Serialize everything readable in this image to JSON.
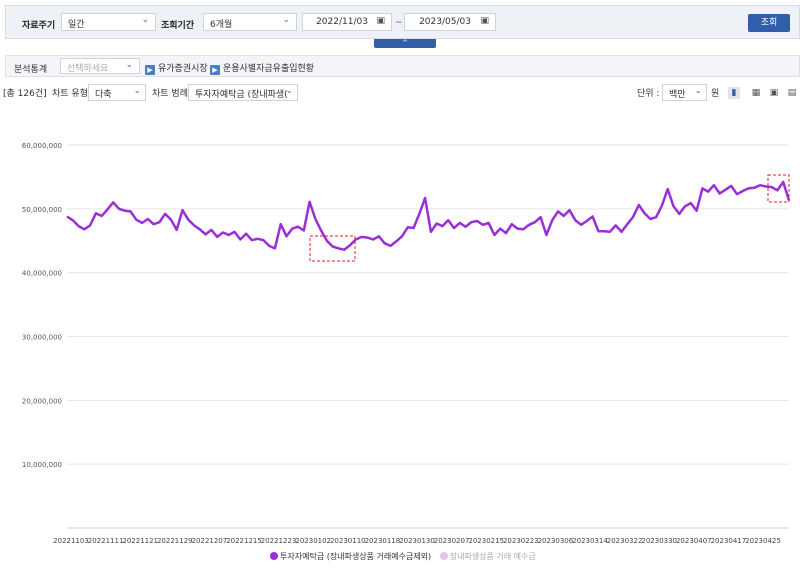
{
  "filter": {
    "period_label": "자료주기",
    "period_value": "일간",
    "range_label": "조회기간",
    "range_value": "6개월",
    "date_from": "2022/11/03",
    "date_to": "2023/05/03",
    "tilde": "~",
    "query_button": "조회",
    "collapse": "^"
  },
  "analysis": {
    "label": "분석통계",
    "placeholder": "선택하세요",
    "link1": "유가증권시장",
    "link2": "운용사별자금유출입현황"
  },
  "toolbar": {
    "count": "[총 126건]",
    "chart_type_label": "차트 유형",
    "chart_type_value": "다축",
    "legend_label": "차트 범례",
    "legend_value": "투자자예탁금 (장내파생(",
    "unit_label": "단위 :",
    "unit_value": "백만",
    "unit_suffix": "원"
  },
  "colors": {
    "series1": "#9b2fd6",
    "series2": "#e0c4f0",
    "accent": "#2f5fa8"
  },
  "chart_data": {
    "type": "line",
    "ylim": [
      0,
      60000000
    ],
    "y_ticks": [
      "10,000,000",
      "20,000,000",
      "30,000,000",
      "40,000,000",
      "50,000,000",
      "60,000,000"
    ],
    "x_tick_labels": [
      "20221103",
      "20221111",
      "20221121",
      "20221129",
      "20221207",
      "20221215",
      "20221223",
      "20230102",
      "20230110",
      "20230118",
      "20230130",
      "20230207",
      "20230215",
      "20230223",
      "20230306",
      "20230314",
      "20230322",
      "20230330",
      "20230407",
      "20230417",
      "20230425"
    ],
    "series": [
      {
        "name": "투자자예탁금 (장내파생상품 거래예수금제외)",
        "values": [
          48800000,
          48200000,
          47300000,
          46800000,
          47400000,
          49300000,
          48900000,
          49900000,
          51000000,
          50000000,
          49700000,
          49600000,
          48300000,
          47800000,
          48400000,
          47600000,
          47900000,
          49200000,
          48300000,
          46700000,
          49800000,
          48300000,
          47400000,
          46800000,
          46000000,
          46700000,
          45600000,
          46300000,
          45900000,
          46400000,
          45200000,
          46100000,
          45100000,
          45300000,
          45100000,
          44200000,
          43800000,
          47600000,
          45700000,
          46900000,
          47200000,
          46600000,
          51100000,
          48400000,
          46600000,
          45000000,
          44100000,
          43800000,
          43600000,
          44300000,
          45200000,
          45600000,
          45500000,
          45200000,
          45700000,
          44600000,
          44200000,
          44900000,
          45700000,
          47100000,
          47000000,
          49200000,
          51700000,
          46400000,
          47700000,
          47300000,
          48200000,
          47000000,
          47800000,
          47200000,
          47900000,
          48100000,
          47500000,
          47800000,
          45900000,
          46900000,
          46200000,
          47600000,
          46900000,
          46800000,
          47500000,
          47900000,
          48700000,
          45900000,
          48200000,
          49600000,
          48900000,
          49800000,
          48200000,
          47500000,
          48100000,
          48800000,
          46500000,
          46500000,
          46400000,
          47400000,
          46400000,
          47600000,
          48700000,
          50600000,
          49300000,
          48400000,
          48700000,
          50500000,
          53100000,
          50400000,
          49200000,
          50400000,
          50900000,
          49700000,
          53200000,
          52700000,
          53700000,
          52400000,
          53000000,
          53600000,
          52300000,
          52800000,
          53200000,
          53300000,
          53700000,
          53500000,
          53400000,
          52900000,
          54200000,
          51300000
        ]
      },
      {
        "name": "장내파생상품 거래 예수금",
        "values": []
      }
    ]
  }
}
